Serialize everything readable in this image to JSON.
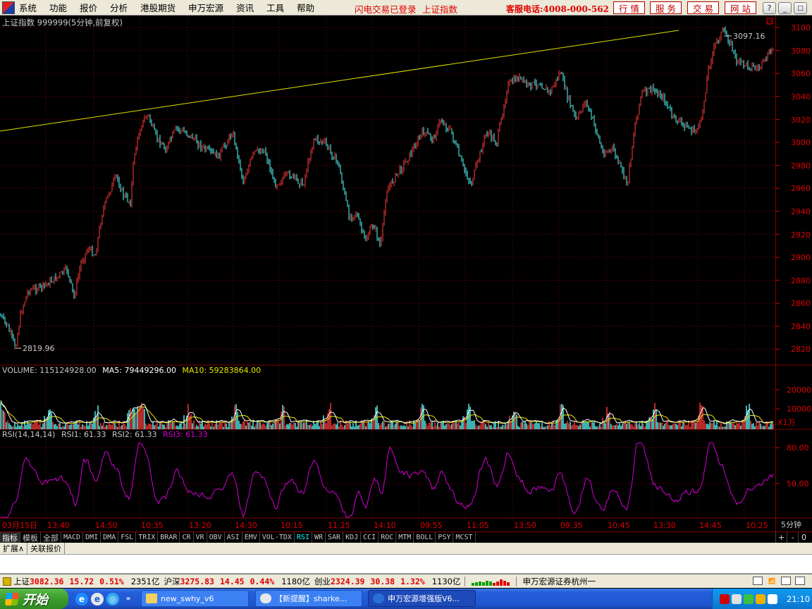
{
  "menubar": {
    "items": [
      "系统",
      "功能",
      "报价",
      "分析",
      "港股期货",
      "申万宏源",
      "资讯",
      "工具",
      "帮助"
    ],
    "status1": "闪电交易已登录",
    "status2": "上证指数",
    "hotline": "客服电话:4008-000-562",
    "quick_buttons": [
      "行情",
      "服务",
      "交易",
      "网站"
    ],
    "window_controls": [
      "?",
      "_",
      "□",
      "×"
    ]
  },
  "chart": {
    "header": "上证指数 999999(5分钟,前复权)",
    "price_axis": [
      "3100",
      "3080",
      "3060",
      "3040",
      "3020",
      "3000",
      "2980",
      "2960",
      "2940",
      "2920",
      "2900",
      "2880",
      "2860",
      "2840",
      "2820"
    ],
    "high_label": "3097.16",
    "low_label": "2819.96",
    "volume_header": {
      "prefix": "VOLUME: 115124928.00",
      "ma5": "MA5: 79449296.00",
      "ma10": "MA10: 59283864.00"
    },
    "volume_axis": [
      "20000",
      "10000"
    ],
    "volume_unit": "X1万",
    "rsi_header": {
      "prefix": "RSI(14,14,14)",
      "rsi1": "RSI1: 61.33",
      "rsi2": "RSI2: 61.33",
      "rsi3": "RSI3: 61.33"
    },
    "rsi_axis": [
      "80.00",
      "50.00"
    ],
    "time_axis": [
      "03月15日",
      "13:40",
      "14:50",
      "10:35",
      "13:20",
      "14:30",
      "10:15",
      "11:25",
      "14:10",
      "09:55",
      "11:05",
      "13:50",
      "09:35",
      "10:45",
      "13:30",
      "14:45",
      "10:25"
    ],
    "period": "5分钟",
    "colors": {
      "up": "#ff3d3d",
      "down": "#54ffff",
      "trendline": "#e0e000",
      "rsi": "#d200d2",
      "ma5": "#ffffff",
      "ma10": "#e8e800",
      "grid": "#800000"
    }
  },
  "indicator_tabs": [
    "指标",
    "模板",
    "全部",
    "MACD",
    "DMI",
    "DMA",
    "FSL",
    "TRIX",
    "BRAR",
    "CR",
    "VR",
    "OBV",
    "ASI",
    "EMV",
    "VOL-TDX",
    "RSI",
    "WR",
    "SAR",
    "KDJ",
    "CCI",
    "ROC",
    "MTM",
    "BOLL",
    "PSY",
    "MCST"
  ],
  "indicator_controls": [
    "+",
    "-",
    "0"
  ],
  "ext_tabs": [
    "扩展∧",
    "关联报价"
  ],
  "ticker": {
    "sh_label": "上证",
    "sh_value": "3082.36",
    "sh_change": "15.72",
    "sh_pct": "0.51%",
    "sh_amount": "2351亿",
    "hs_label": "沪深",
    "hs_value": "3275.83",
    "hs_change": "14.45",
    "hs_pct": "0.44%",
    "hs_amount": "1180亿",
    "cy_label": "创业",
    "cy_value": "2324.39",
    "cy_change": "30.38",
    "cy_pct": "1.32%",
    "cy_amount": "1130亿",
    "broker": "申万宏源证券杭州一"
  },
  "taskbar": {
    "start": "开始",
    "tasks": [
      "new_swhy_v6",
      "【新提醒】sharke...",
      "申万宏源增强版V6..."
    ],
    "clock": "21:10"
  }
}
